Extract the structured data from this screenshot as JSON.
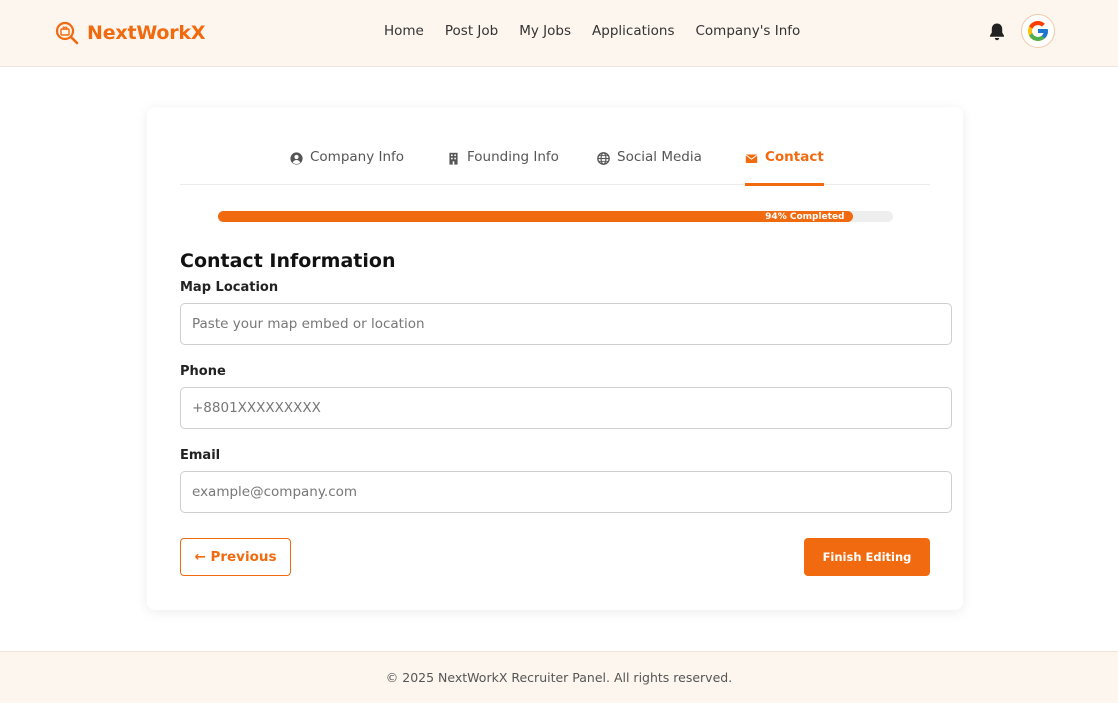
{
  "brand": {
    "name": "NextWorkX",
    "accent_color": "#f26a0f",
    "icon": "magnifier-briefcase-icon"
  },
  "nav": {
    "items": [
      {
        "label": "Home"
      },
      {
        "label": "Post Job"
      },
      {
        "label": "My Jobs"
      },
      {
        "label": "Applications"
      },
      {
        "label": "Company's Info"
      }
    ]
  },
  "header": {
    "notification_icon": "bell-icon",
    "avatar_icon": "google-g-icon"
  },
  "tabs": [
    {
      "label": "Company Info",
      "icon": "user-circle-icon",
      "active": false
    },
    {
      "label": "Founding Info",
      "icon": "building-icon",
      "active": false
    },
    {
      "label": "Social Media",
      "icon": "globe-icon",
      "active": false
    },
    {
      "label": "Contact",
      "icon": "envelope-icon",
      "active": true
    }
  ],
  "progress": {
    "percent": 94,
    "label": "94% Completed"
  },
  "form": {
    "title": "Contact Information",
    "fields": [
      {
        "label": "Map Location",
        "placeholder": "Paste your map embed or location",
        "value": ""
      },
      {
        "label": "Phone",
        "placeholder": "+8801XXXXXXXXX",
        "value": ""
      },
      {
        "label": "Email",
        "placeholder": "example@company.com",
        "value": ""
      }
    ],
    "previous_label": "← Previous",
    "finish_label": "Finish Editing"
  },
  "footer": {
    "text": "© 2025 NextWorkX Recruiter Panel. All rights reserved."
  }
}
